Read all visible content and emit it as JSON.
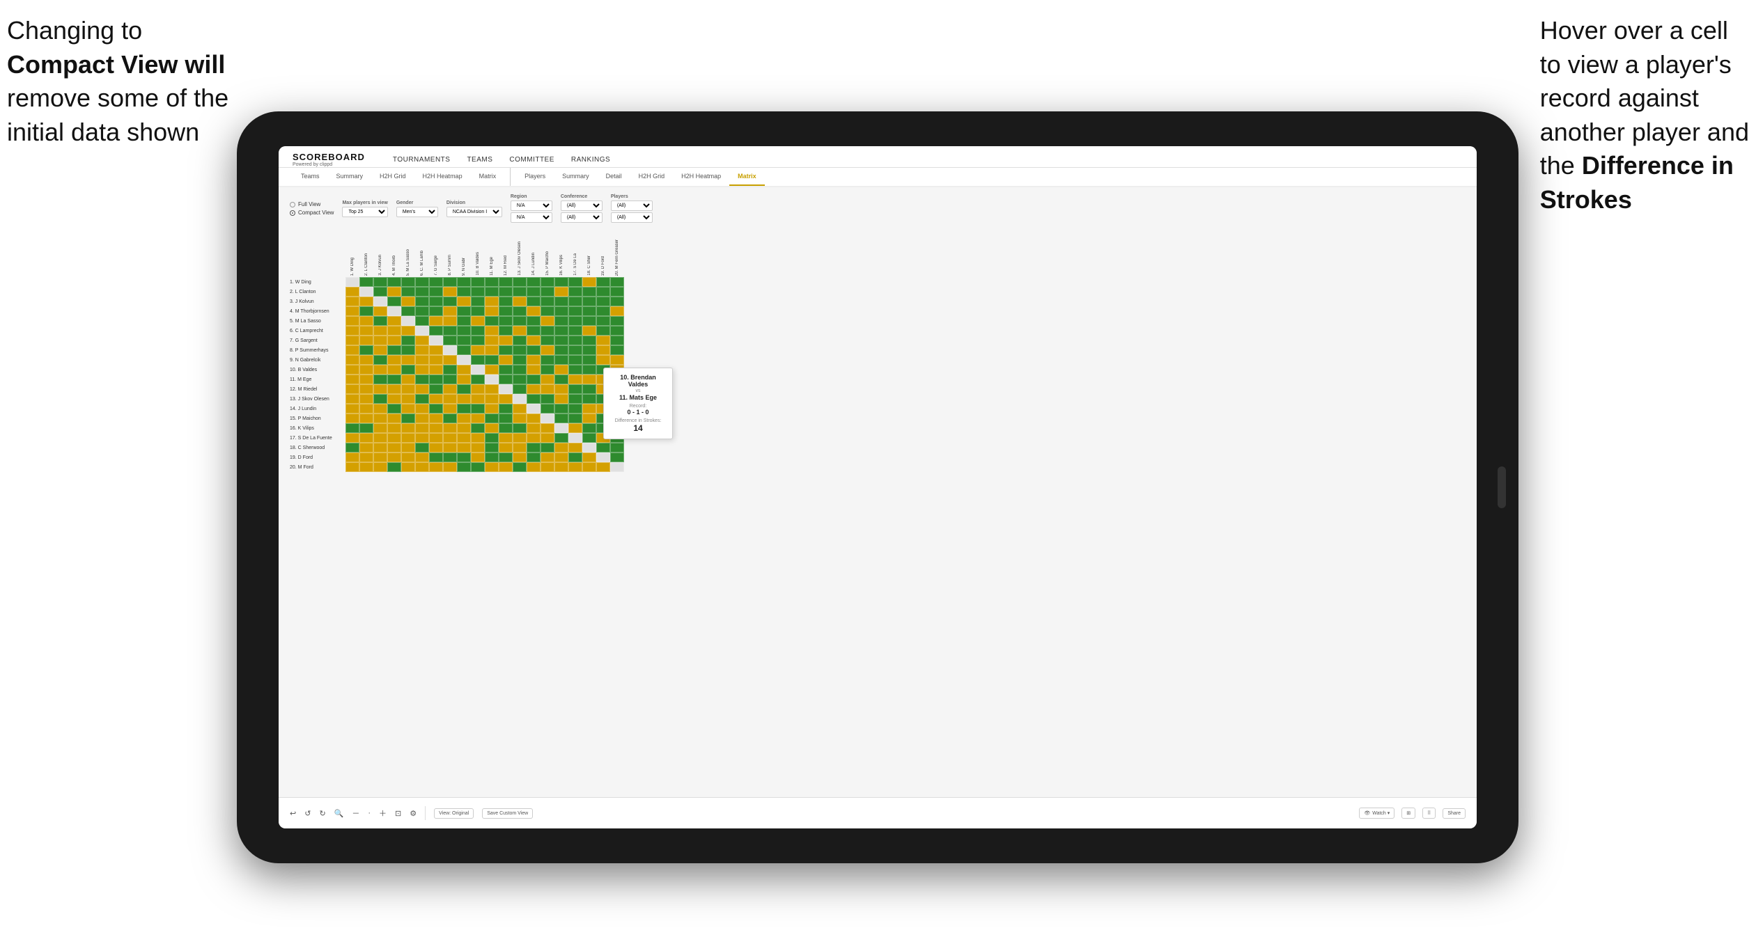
{
  "annotations": {
    "left_line1": "Changing to",
    "left_bold": "Compact View",
    "left_line2": " will",
    "left_line3": "remove some of the",
    "left_line4": "initial data shown",
    "right_line1": "Hover over a cell",
    "right_line2": "to view a player's",
    "right_line3": "record against",
    "right_line4": "another player and",
    "right_line5": "the ",
    "right_bold": "Difference in",
    "right_line6": "Strokes"
  },
  "nav": {
    "logo": "SCOREBOARD",
    "logo_sub": "Powered by clippd",
    "items": [
      "TOURNAMENTS",
      "TEAMS",
      "COMMITTEE",
      "RANKINGS"
    ]
  },
  "sub_tabs": {
    "left_group": [
      "Teams",
      "Summary",
      "H2H Grid",
      "H2H Heatmap",
      "Matrix"
    ],
    "right_group": [
      "Players",
      "Summary",
      "Detail",
      "H2H Grid",
      "H2H Heatmap",
      "Matrix"
    ],
    "active": "Matrix"
  },
  "filters": {
    "view_full": "Full View",
    "view_compact": "Compact View",
    "max_players_label": "Max players in view",
    "max_players_value": "Top 25",
    "gender_label": "Gender",
    "gender_value": "Men's",
    "division_label": "Division",
    "division_value": "NCAA Division I",
    "region_label": "Region",
    "region_value": "N/A",
    "region_value2": "N/A",
    "conference_label": "Conference",
    "conference_value": "(All)",
    "conference_value2": "(All)",
    "players_label": "Players",
    "players_value": "(All)",
    "players_value2": "(All)"
  },
  "players": [
    "1. W Ding",
    "2. L Clanton",
    "3. J Kolvun",
    "4. M Thorbjornsen",
    "5. M La Sasso",
    "6. C Lamprecht",
    "7. G Sargent",
    "8. P Summerhays",
    "9. N Gabrelcik",
    "10. B Valdes",
    "11. M Ege",
    "12. M Riedel",
    "13. J Skov Olesen",
    "14. J Lundin",
    "15. P Maichon",
    "16. K Vilips",
    "17. S De La Fuente",
    "18. C Sherwood",
    "19. D Ford",
    "20. M Ford"
  ],
  "col_headers": [
    "1. W Ding",
    "2. L Clanton",
    "3. J Kolvun",
    "4. M Thorb...",
    "5. M La Sasso",
    "6. C. M Lamb...",
    "7. G Sarge...",
    "8. P Summ...",
    "9. N Gabr...",
    "10. B Valdes",
    "11. M Ege",
    "12. M Ried...",
    "13. J Skov Olesen",
    "14. J Lundin",
    "15. P Maicho...",
    "16. K Vilips",
    "17. S De La...",
    "18. C Sher...",
    "19. D Ford",
    "20. M Fern... Greaser"
  ],
  "tooltip": {
    "player1": "10. Brendan Valdes",
    "vs": "vs",
    "player2": "11. Mats Ege",
    "record_label": "Record:",
    "record": "0 - 1 - 0",
    "diff_label": "Difference in Strokes:",
    "diff_value": "14"
  },
  "toolbar": {
    "undo": "↩",
    "redo_back": "↺",
    "redo_fwd": "↻",
    "zoom_out": "⊖",
    "zoom_in": "⊕",
    "settings": "⚙",
    "view_original": "View: Original",
    "save_custom": "Save Custom View",
    "watch": "Watch ▾",
    "share": "Share",
    "watch_icon": "👁"
  }
}
